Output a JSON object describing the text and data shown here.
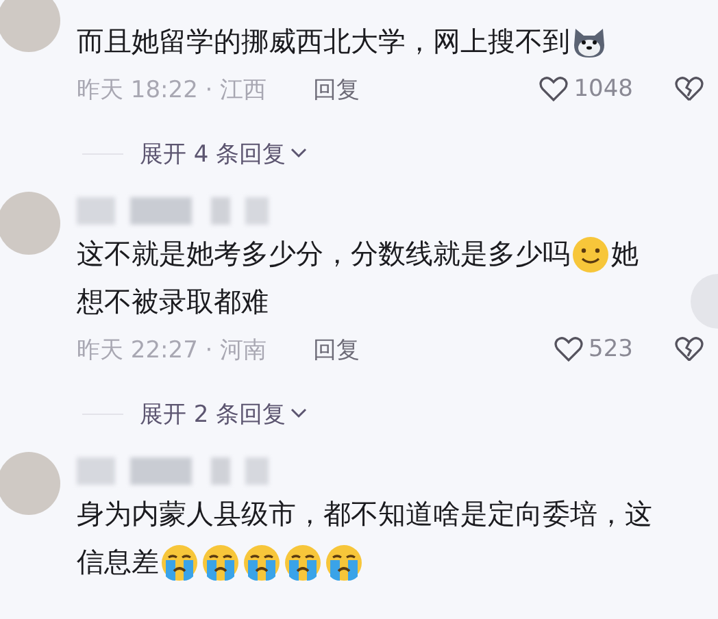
{
  "comments": [
    {
      "name_blurred": false,
      "lines": [
        [
          {
            "kind": "text",
            "text": "而且她留学的挪威西北大学，网上搜不到"
          },
          {
            "kind": "dog_emoji"
          }
        ]
      ],
      "meta": {
        "time": "昨天 18:22 · 江西",
        "reply": "回复",
        "likes": "1048"
      },
      "expand": "展开 4 条回复"
    },
    {
      "name_blurred": true,
      "lines": [
        [
          {
            "kind": "text",
            "text": "这不就是她考多少分，分数线就是多少吗"
          },
          {
            "kind": "smile_emoji"
          },
          {
            "kind": "text",
            "text": "她"
          }
        ],
        [
          {
            "kind": "text",
            "text": "想不被录取都难"
          }
        ]
      ],
      "meta": {
        "time": "昨天 22:27 · 河南",
        "reply": "回复",
        "likes": "523"
      },
      "expand": "展开 2 条回复"
    },
    {
      "name_blurred": true,
      "lines": [
        [
          {
            "kind": "text",
            "text": "身为内蒙人县级市，都不知道啥是定向委培，这"
          }
        ],
        [
          {
            "kind": "text",
            "text": "信息差"
          },
          {
            "kind": "cry_emoji"
          },
          {
            "kind": "cry_emoji"
          },
          {
            "kind": "cry_emoji"
          },
          {
            "kind": "cry_emoji"
          },
          {
            "kind": "cry_emoji"
          }
        ]
      ]
    }
  ]
}
